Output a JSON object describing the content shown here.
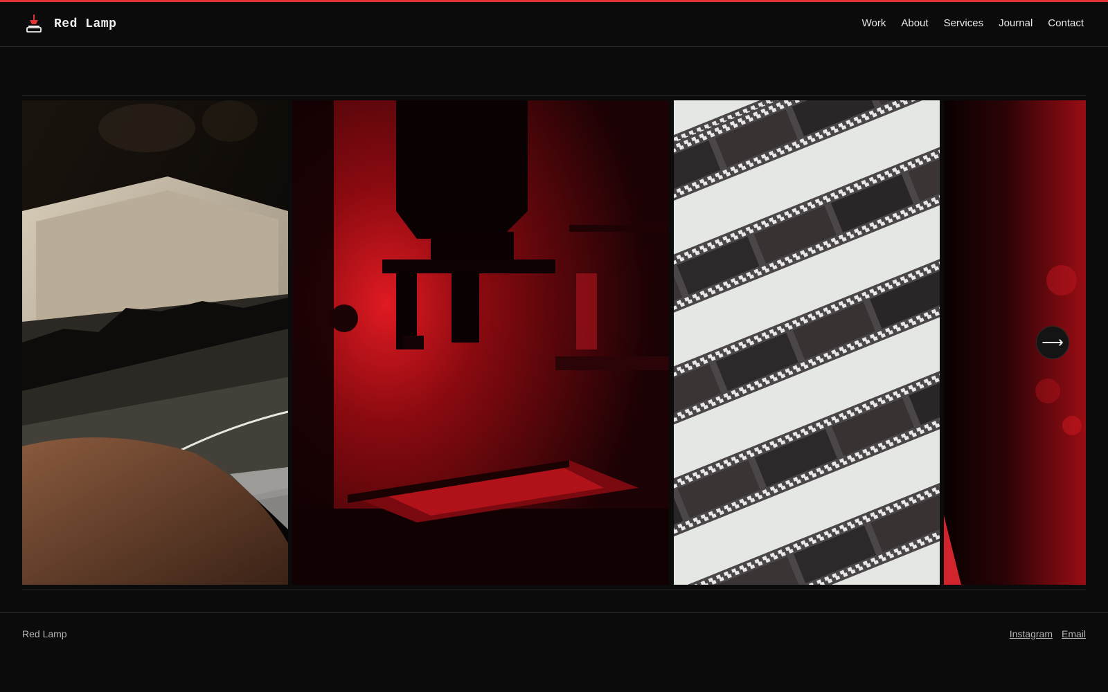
{
  "header": {
    "brand": "Red Lamp",
    "nav": [
      "Work",
      "About",
      "Services",
      "Journal",
      "Contact"
    ]
  },
  "gallery": {
    "next_glyph": "⟶",
    "images": [
      "darkroom-tray-photo",
      "enlarger-red-light-photo",
      "film-negatives-photo",
      "red-light-photo"
    ]
  },
  "footer": {
    "brand": "Red Lamp",
    "links": [
      "Instagram",
      "Email"
    ]
  },
  "colors": {
    "accent": "#e03434",
    "background": "#0b0b0b"
  }
}
